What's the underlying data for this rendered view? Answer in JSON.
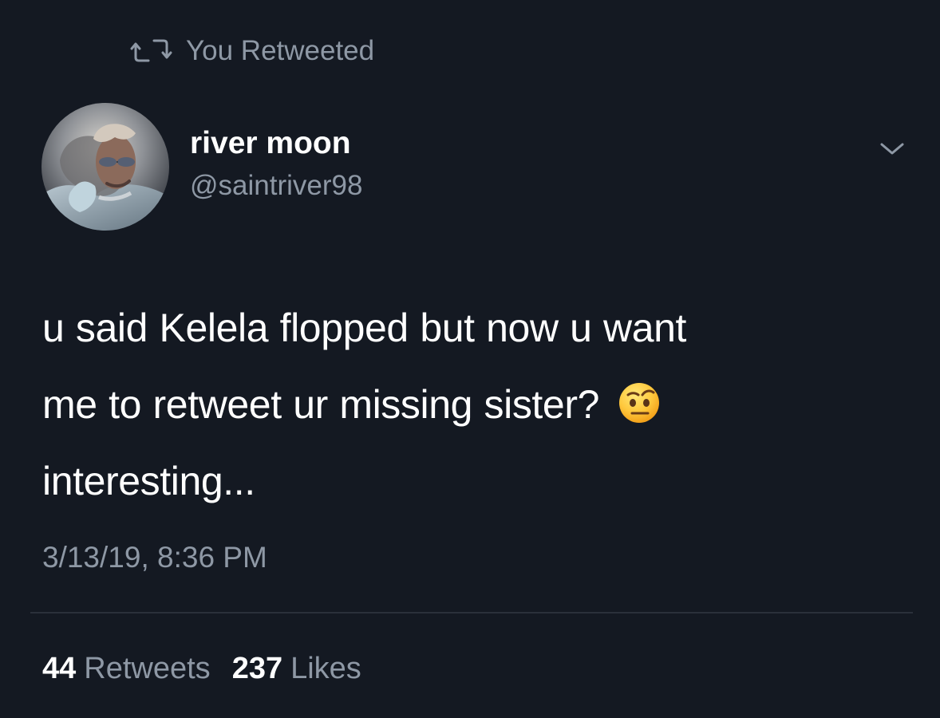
{
  "retweet_banner": {
    "text": "You Retweeted",
    "icon": "retweet-icon"
  },
  "author": {
    "display_name": "river moon",
    "handle": "@saintriver98",
    "avatar": "profile-avatar"
  },
  "tweet": {
    "lines": [
      "u said Kelela flopped but now u want",
      "me to retweet ur missing sister?",
      "interesting..."
    ],
    "emoji": "face-with-raised-eyebrow-emoji",
    "timestamp": "3/13/19, 8:36 PM"
  },
  "stats": {
    "retweets_count": "44",
    "retweets_label": "Retweets",
    "likes_count": "237",
    "likes_label": "Likes"
  },
  "colors": {
    "background": "#141922",
    "primary_text": "#ffffff",
    "secondary_text": "#8e98a5",
    "divider": "#2a303a"
  },
  "icons": {
    "menu": "chevron-down-icon"
  }
}
